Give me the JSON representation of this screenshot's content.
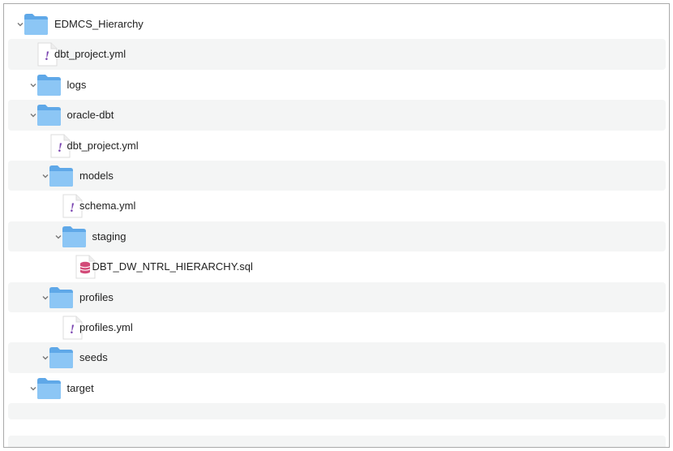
{
  "colors": {
    "folder": "#5fa8e8",
    "folder_light": "#8cc6f5",
    "yaml_mark": "#7a44b0",
    "sql_db": "#d24a78"
  },
  "tree": [
    {
      "name": "EDMCS_Hierarchy",
      "type": "folder",
      "depth": 0,
      "expanded": true
    },
    {
      "name": "dbt_project.yml",
      "type": "yaml",
      "depth": 1
    },
    {
      "name": "logs",
      "type": "folder",
      "depth": 1,
      "expanded": true
    },
    {
      "name": "oracle-dbt",
      "type": "folder",
      "depth": 1,
      "expanded": true
    },
    {
      "name": "dbt_project.yml",
      "type": "yaml",
      "depth": 2
    },
    {
      "name": "models",
      "type": "folder",
      "depth": 2,
      "expanded": true
    },
    {
      "name": "schema.yml",
      "type": "yaml",
      "depth": 3
    },
    {
      "name": "staging",
      "type": "folder",
      "depth": 3,
      "expanded": true
    },
    {
      "name": "DBT_DW_NTRL_HIERARCHY.sql",
      "type": "sql",
      "depth": 4
    },
    {
      "name": "profiles",
      "type": "folder",
      "depth": 2,
      "expanded": true
    },
    {
      "name": "profiles.yml",
      "type": "yaml",
      "depth": 3
    },
    {
      "name": "seeds",
      "type": "folder",
      "depth": 2,
      "expanded": true
    },
    {
      "name": "target",
      "type": "folder",
      "depth": 1,
      "expanded": true
    }
  ]
}
